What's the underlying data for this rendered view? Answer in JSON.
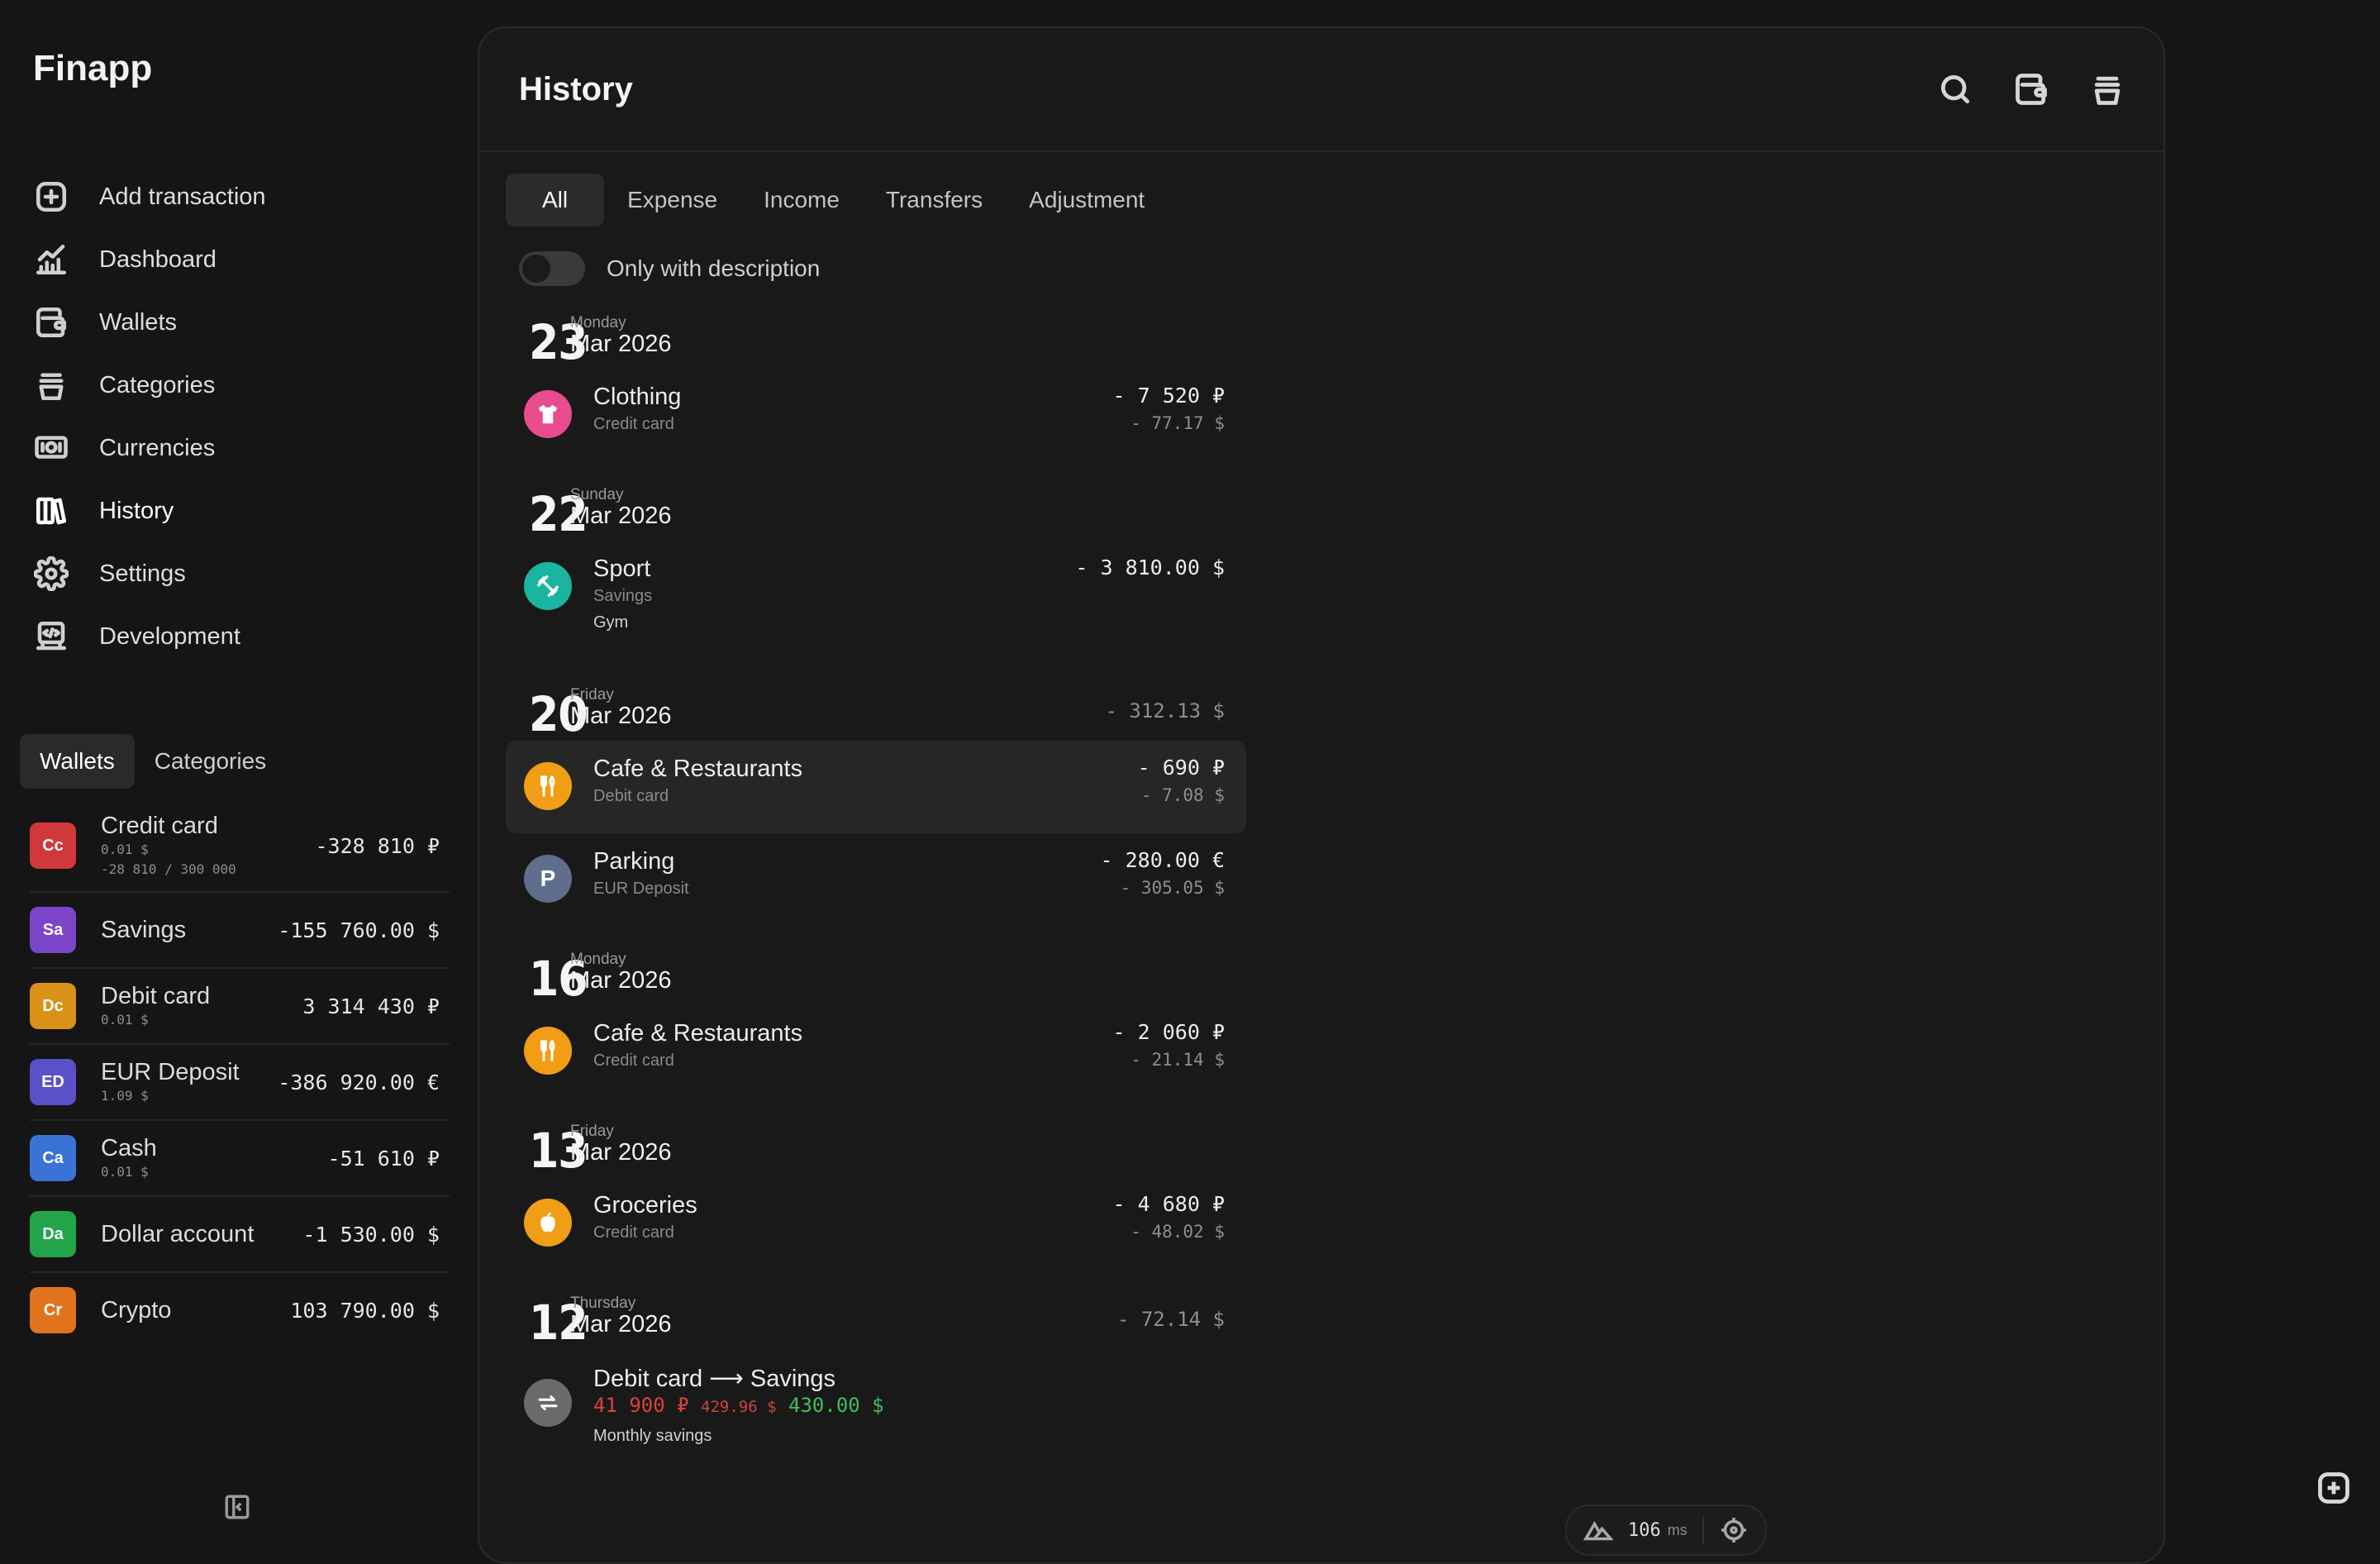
{
  "app": {
    "title": "Finapp"
  },
  "nav": [
    {
      "label": "Add transaction",
      "icon": "plus-square-icon"
    },
    {
      "label": "Dashboard",
      "icon": "chart-icon"
    },
    {
      "label": "Wallets",
      "icon": "wallet-icon"
    },
    {
      "label": "Categories",
      "icon": "basket-icon"
    },
    {
      "label": "Currencies",
      "icon": "banknote-icon"
    },
    {
      "label": "History",
      "icon": "books-icon",
      "active": true
    },
    {
      "label": "Settings",
      "icon": "gear-icon"
    },
    {
      "label": "Development",
      "icon": "code-terminal-icon"
    }
  ],
  "sidebar_tabs": {
    "wallets": "Wallets",
    "categories": "Categories",
    "active": "Wallets"
  },
  "wallets": [
    {
      "badge": "Cc",
      "color": "#d1383c",
      "name": "Credit card",
      "sub1": "0.01 $",
      "sub2": "-28 810 / 300 000",
      "amount": "-328 810 ₽"
    },
    {
      "badge": "Sa",
      "color": "#7b45c9",
      "name": "Savings",
      "sub1": "",
      "sub2": "",
      "amount": "-155 760.00 $"
    },
    {
      "badge": "Dc",
      "color": "#d99117",
      "name": "Debit card",
      "sub1": "0.01 $",
      "sub2": "",
      "amount": "3 314 430 ₽"
    },
    {
      "badge": "ED",
      "color": "#5a50c8",
      "name": "EUR Deposit",
      "sub1": "1.09 $",
      "sub2": "",
      "amount": "-386 920.00 €"
    },
    {
      "badge": "Ca",
      "color": "#3a72d6",
      "name": "Cash",
      "sub1": "0.01 $",
      "sub2": "",
      "amount": "-51 610 ₽"
    },
    {
      "badge": "Da",
      "color": "#22a44a",
      "name": "Dollar account",
      "sub1": "",
      "sub2": "",
      "amount": "-1 530.00 $"
    },
    {
      "badge": "Cr",
      "color": "#e0731c",
      "name": "Crypto",
      "sub1": "",
      "sub2": "",
      "amount": "103 790.00 $"
    }
  ],
  "page": {
    "title": "History"
  },
  "header_icons": [
    "search-icon",
    "wallet-icon",
    "basket-icon"
  ],
  "filters": [
    "All",
    "Expense",
    "Income",
    "Transfers",
    "Adjustment"
  ],
  "active_filter": "All",
  "toggle": {
    "label": "Only with description",
    "on": false
  },
  "days": [
    {
      "day": "23",
      "weekday": "Monday",
      "month": "Mar 2026",
      "total": "",
      "items": [
        {
          "name": "Clothing",
          "wallet": "Credit card",
          "note": "",
          "amount": "- 7 520 ₽",
          "amount_alt": "- 77.17 $",
          "icon": "tshirt-icon",
          "color": "#e84c8f"
        }
      ]
    },
    {
      "day": "22",
      "weekday": "Sunday",
      "month": "Mar 2026",
      "total": "",
      "items": [
        {
          "name": "Sport",
          "wallet": "Savings",
          "note": "Gym",
          "amount": "- 3 810.00 $",
          "amount_alt": "",
          "icon": "dumbbell-icon",
          "color": "#19b5a0"
        }
      ]
    },
    {
      "day": "20",
      "weekday": "Friday",
      "month": "Mar 2026",
      "total": "- 312.13 $",
      "items": [
        {
          "name": "Cafe & Restaurants",
          "wallet": "Debit card",
          "note": "",
          "amount": "- 690 ₽",
          "amount_alt": "- 7.08 $",
          "icon": "fork-knife-icon",
          "color": "#f29d16",
          "highlight": true
        },
        {
          "name": "Parking",
          "wallet": "EUR Deposit",
          "note": "",
          "amount": "- 280.00 €",
          "amount_alt": "- 305.05 $",
          "icon": "parking-icon",
          "color": "#5e6e8c"
        }
      ]
    },
    {
      "day": "16",
      "weekday": "Monday",
      "month": "Mar 2026",
      "total": "",
      "items": [
        {
          "name": "Cafe & Restaurants",
          "wallet": "Credit card",
          "note": "",
          "amount": "- 2 060 ₽",
          "amount_alt": "- 21.14 $",
          "icon": "fork-knife-icon",
          "color": "#f29d16"
        }
      ]
    },
    {
      "day": "13",
      "weekday": "Friday",
      "month": "Mar 2026",
      "total": "",
      "items": [
        {
          "name": "Groceries",
          "wallet": "Credit card",
          "note": "",
          "amount": "- 4 680 ₽",
          "amount_alt": "- 48.02 $",
          "icon": "apple-icon",
          "color": "#f29d16"
        }
      ]
    },
    {
      "day": "12",
      "weekday": "Thursday",
      "month": "Mar 2026",
      "total": "- 72.14 $",
      "transfer": {
        "name": "Debit card ⟶ Savings",
        "from_amount": "41 900 ₽",
        "from_alt": "429.96 $",
        "to_amount": "430.00 $",
        "note": "Monthly savings",
        "icon": "transfer-icon",
        "color": "#6a6a6a"
      }
    }
  ],
  "perf": {
    "value": "106",
    "unit": "ms",
    "logo": "nuxt-logo-icon",
    "target": "crosshair-icon"
  },
  "float_button": {
    "icon": "plus-square-icon"
  }
}
